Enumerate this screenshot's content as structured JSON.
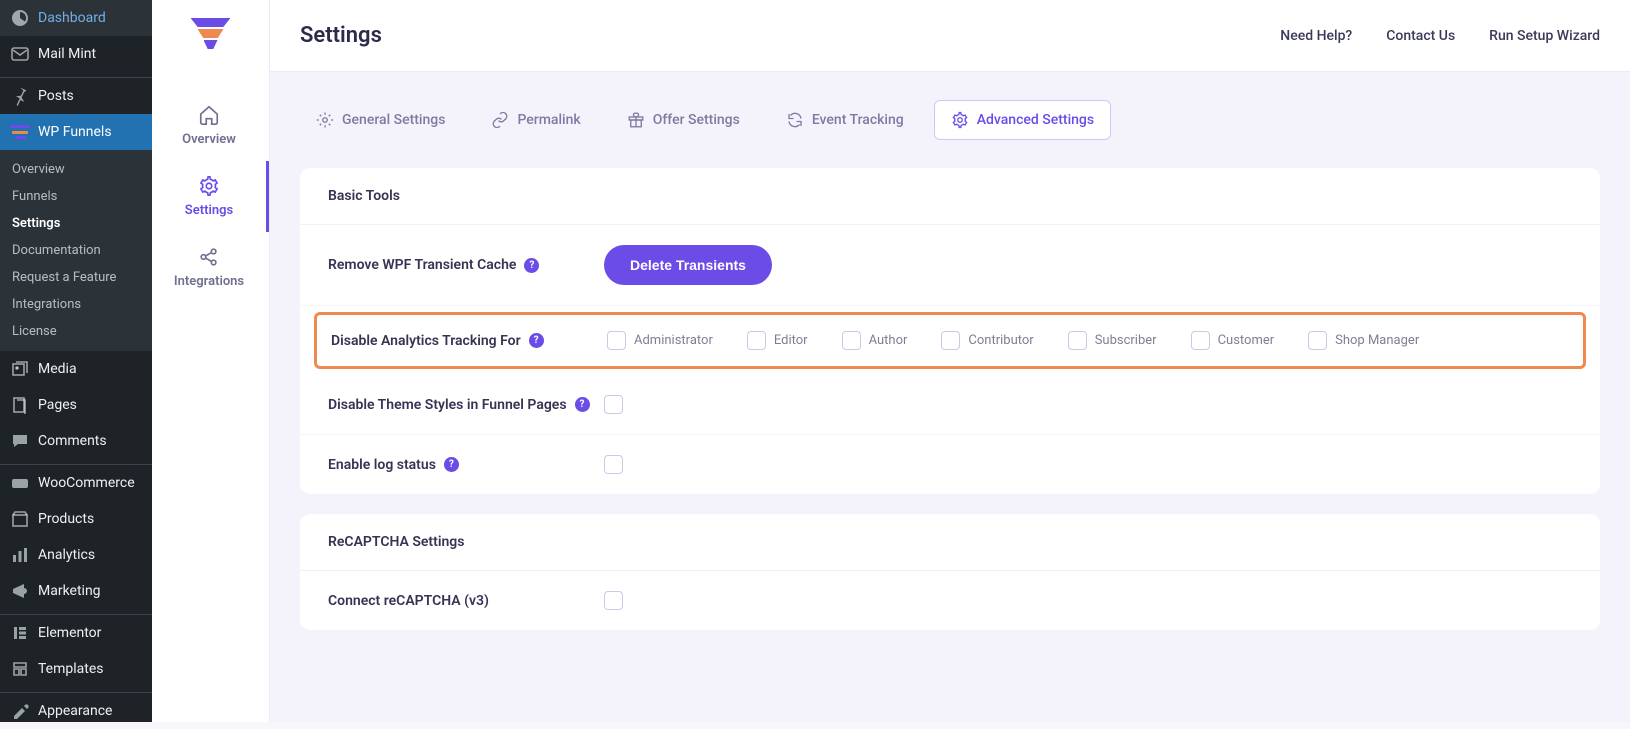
{
  "wp_sidebar": {
    "items_top": [
      {
        "label": "Dashboard",
        "icon": "dashboard"
      },
      {
        "label": "Mail Mint",
        "icon": "mail"
      }
    ],
    "items_mid": [
      {
        "label": "Posts",
        "icon": "pin"
      }
    ],
    "wpf_label": "WP Funnels",
    "wpf_sub": [
      {
        "label": "Overview"
      },
      {
        "label": "Funnels"
      },
      {
        "label": "Settings",
        "active": true
      },
      {
        "label": "Documentation"
      },
      {
        "label": "Request a Feature"
      },
      {
        "label": "Integrations"
      },
      {
        "label": "License"
      }
    ],
    "items_after": [
      {
        "label": "Media",
        "icon": "media"
      },
      {
        "label": "Pages",
        "icon": "pages"
      },
      {
        "label": "Comments",
        "icon": "comment"
      }
    ],
    "items_commerce": [
      {
        "label": "WooCommerce",
        "icon": "woo"
      },
      {
        "label": "Products",
        "icon": "products"
      },
      {
        "label": "Analytics",
        "icon": "analytics"
      },
      {
        "label": "Marketing",
        "icon": "marketing"
      }
    ],
    "items_design": [
      {
        "label": "Elementor",
        "icon": "elementor"
      },
      {
        "label": "Templates",
        "icon": "templates"
      }
    ],
    "items_last": [
      {
        "label": "Appearance",
        "icon": "appearance"
      }
    ]
  },
  "wpf_side": {
    "items": [
      {
        "label": "Overview"
      },
      {
        "label": "Settings",
        "active": true
      },
      {
        "label": "Integrations"
      }
    ]
  },
  "header": {
    "title": "Settings",
    "links": [
      "Need Help?",
      "Contact Us",
      "Run Setup Wizard"
    ]
  },
  "tabs": [
    {
      "label": "General Settings"
    },
    {
      "label": "Permalink"
    },
    {
      "label": "Offer Settings"
    },
    {
      "label": "Event Tracking"
    },
    {
      "label": "Advanced Settings",
      "active": true
    }
  ],
  "panel1": {
    "title": "Basic Tools",
    "row_remove_cache": "Remove WPF Transient Cache",
    "btn_delete": "Delete Transients",
    "row_disable_analytics": "Disable Analytics Tracking For",
    "roles": [
      "Administrator",
      "Editor",
      "Author",
      "Contributor",
      "Subscriber",
      "Customer",
      "Shop Manager"
    ],
    "row_disable_theme": "Disable Theme Styles in Funnel Pages",
    "row_enable_log": "Enable log status"
  },
  "panel2": {
    "title": "ReCAPTCHA Settings",
    "row_connect": "Connect reCAPTCHA (v3)"
  }
}
